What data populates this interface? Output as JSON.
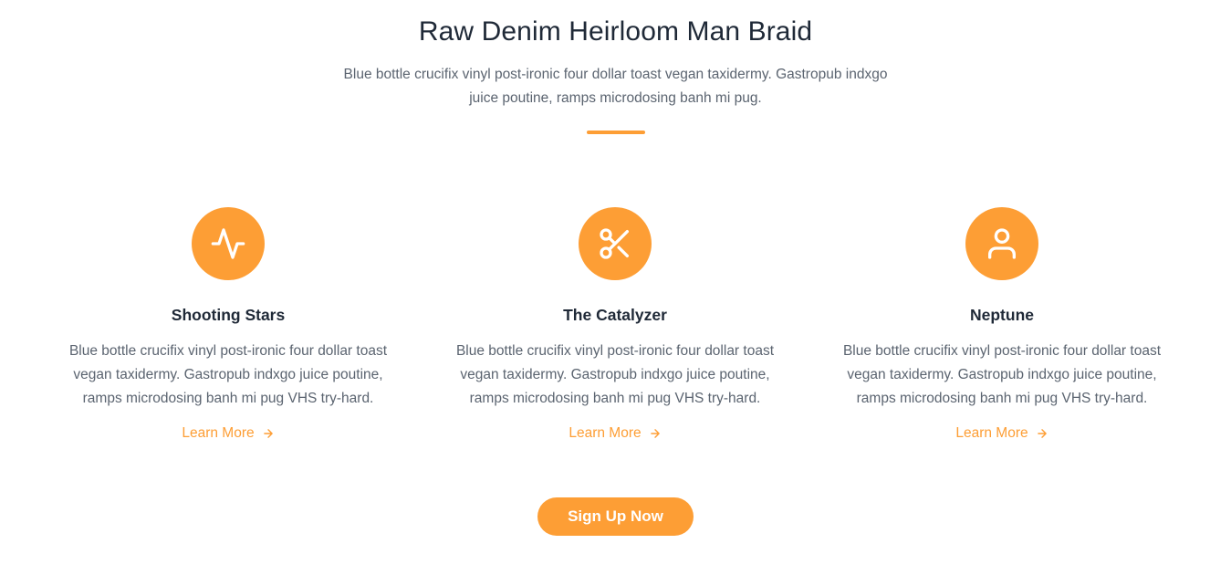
{
  "colors": {
    "accent": "#fd9e35",
    "heading": "#1f2937",
    "body_text": "#5b6470"
  },
  "header": {
    "title": "Raw Denim Heirloom Man Braid",
    "subtitle": "Blue bottle crucifix vinyl post-ironic four dollar toast vegan taxidermy. Gastropub indxgo juice poutine, ramps microdosing banh mi pug."
  },
  "features": [
    {
      "icon": "activity-icon",
      "title": "Shooting Stars",
      "text": "Blue bottle crucifix vinyl post-ironic four dollar toast vegan taxidermy. Gastropub indxgo juice poutine, ramps microdosing banh mi pug VHS try-hard.",
      "link_label": "Learn More",
      "link_icon": "arrow-right-icon"
    },
    {
      "icon": "scissors-icon",
      "title": "The Catalyzer",
      "text": "Blue bottle crucifix vinyl post-ironic four dollar toast vegan taxidermy. Gastropub indxgo juice poutine, ramps microdosing banh mi pug VHS try-hard.",
      "link_label": "Learn More",
      "link_icon": "arrow-right-icon"
    },
    {
      "icon": "user-icon",
      "title": "Neptune",
      "text": "Blue bottle crucifix vinyl post-ironic four dollar toast vegan taxidermy. Gastropub indxgo juice poutine, ramps microdosing banh mi pug VHS try-hard.",
      "link_label": "Learn More",
      "link_icon": "arrow-right-icon"
    }
  ],
  "cta": {
    "label": "Sign Up Now"
  }
}
